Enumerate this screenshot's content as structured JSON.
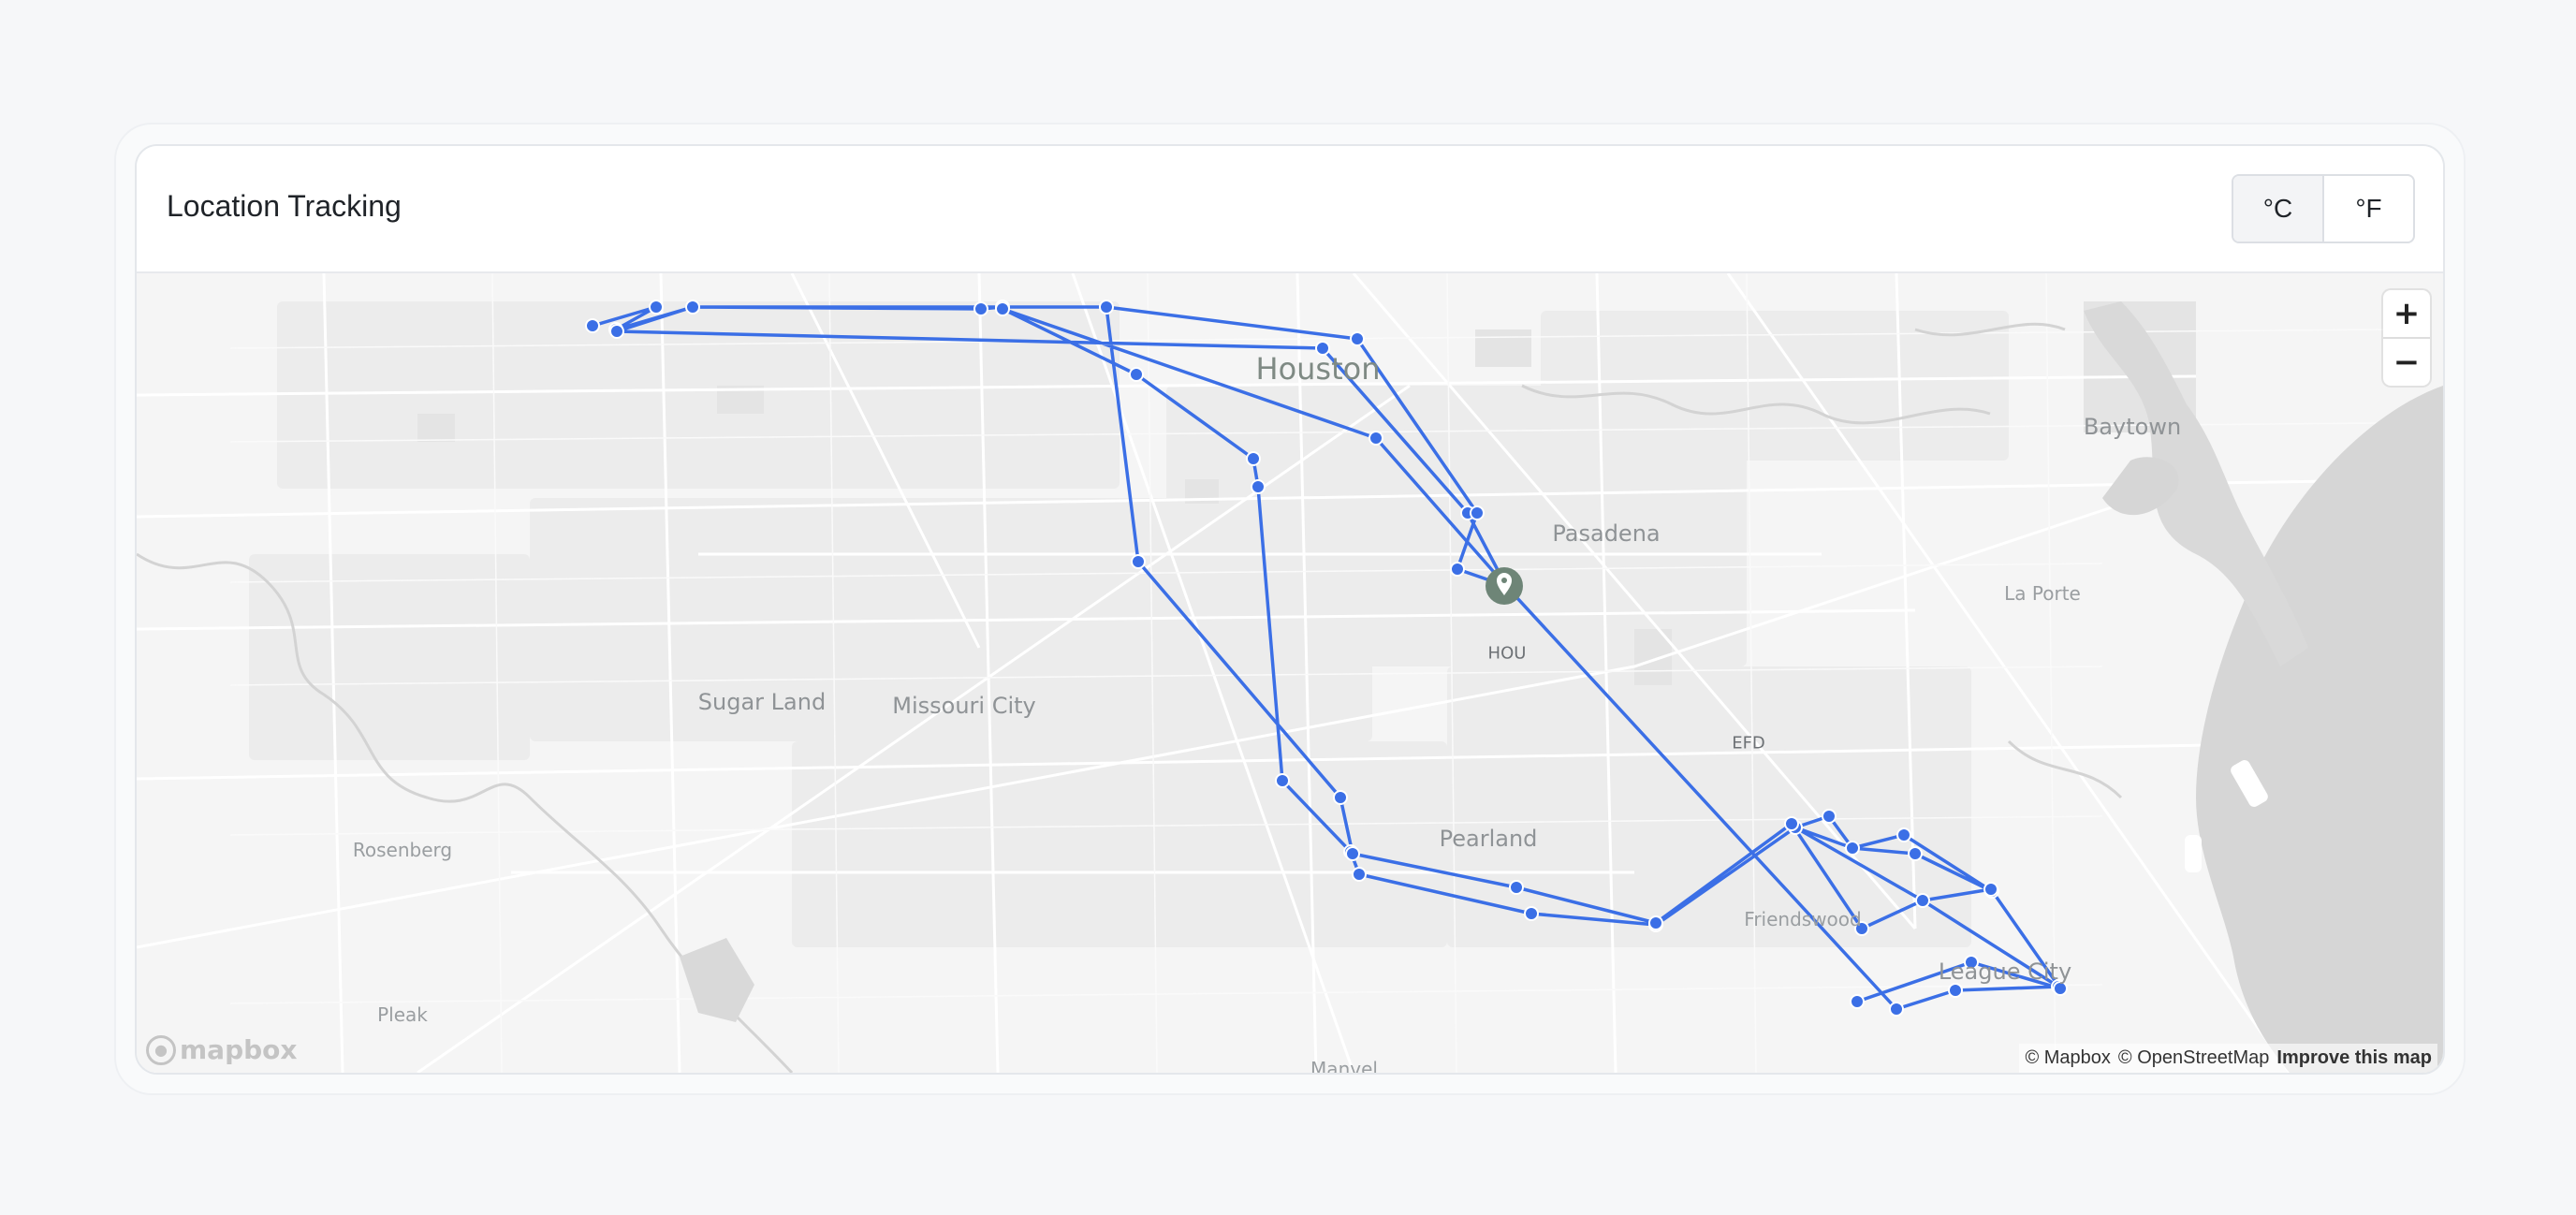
{
  "header": {
    "title": "Location Tracking",
    "unit_celsius": "°C",
    "unit_fahrenheit": "°F",
    "selected_unit": "°C"
  },
  "map": {
    "labels": {
      "houston": "Houston",
      "baytown": "Baytown",
      "pasadena": "Pasadena",
      "la_porte": "La Porte",
      "hou": "HOU",
      "efd": "EFD",
      "sugar_land": "Sugar Land",
      "missouri_city": "Missouri City",
      "rosenberg": "Rosenberg",
      "pearland": "Pearland",
      "friendswood": "Friendswood",
      "league_city": "League City",
      "pleak": "Pleak",
      "manvel": "Manvel"
    },
    "zoom_in": "+",
    "zoom_out": "−",
    "logo": "mapbox",
    "attribution_mapbox": "© Mapbox",
    "attribution_osm": "© OpenStreetMap",
    "improve": "Improve this map",
    "route_color": "#3b6fe6",
    "marker_color": "#6e8577",
    "marker_icon": "map-pin-icon"
  }
}
